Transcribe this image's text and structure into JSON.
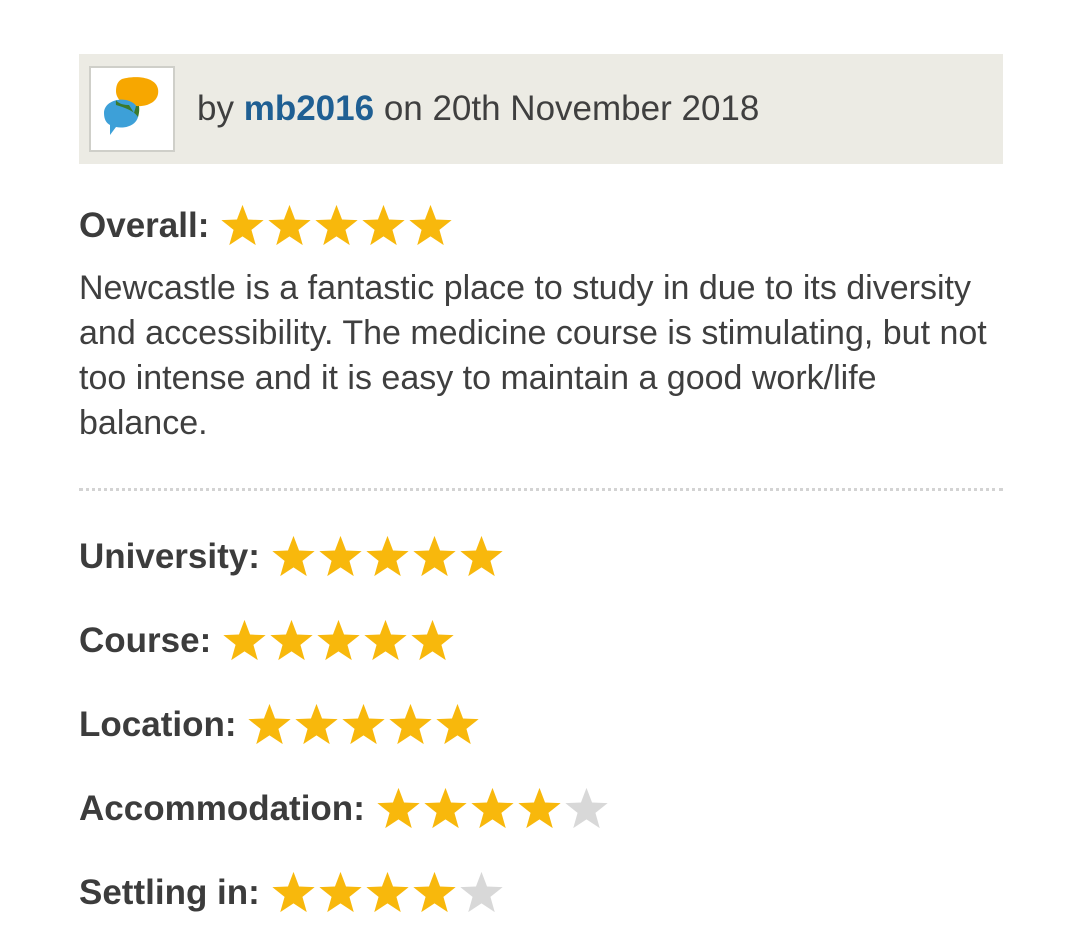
{
  "review": {
    "by_prefix": "by",
    "author": "mb2016",
    "date_text": "on 20th November 2018",
    "overall": {
      "label": "Overall:",
      "stars": 5,
      "max": 5
    },
    "comment": "Newcastle is a fantastic place to study in due to its diversity and accessibility. The medicine course is stimulating, but not too intense and it is easy to maintain a good work/life balance.",
    "ratings": [
      {
        "label": "University:",
        "stars": 5,
        "max": 5
      },
      {
        "label": "Course:",
        "stars": 5,
        "max": 5
      },
      {
        "label": "Location:",
        "stars": 5,
        "max": 5
      },
      {
        "label": "Accommodation:",
        "stars": 4,
        "max": 5
      },
      {
        "label": "Settling in:",
        "stars": 4,
        "max": 5
      }
    ]
  },
  "colors": {
    "star_filled": "#f8b80c",
    "star_empty": "#d8d8d8",
    "author_link": "#1f5f93",
    "header_bg": "#ecebe4",
    "avatar_orange": "#f7a700",
    "avatar_blue": "#3da0d8",
    "avatar_overlap": "#3b7a2e"
  },
  "icons": {
    "avatar": "speech-bubbles-icon",
    "star": "star-icon"
  }
}
